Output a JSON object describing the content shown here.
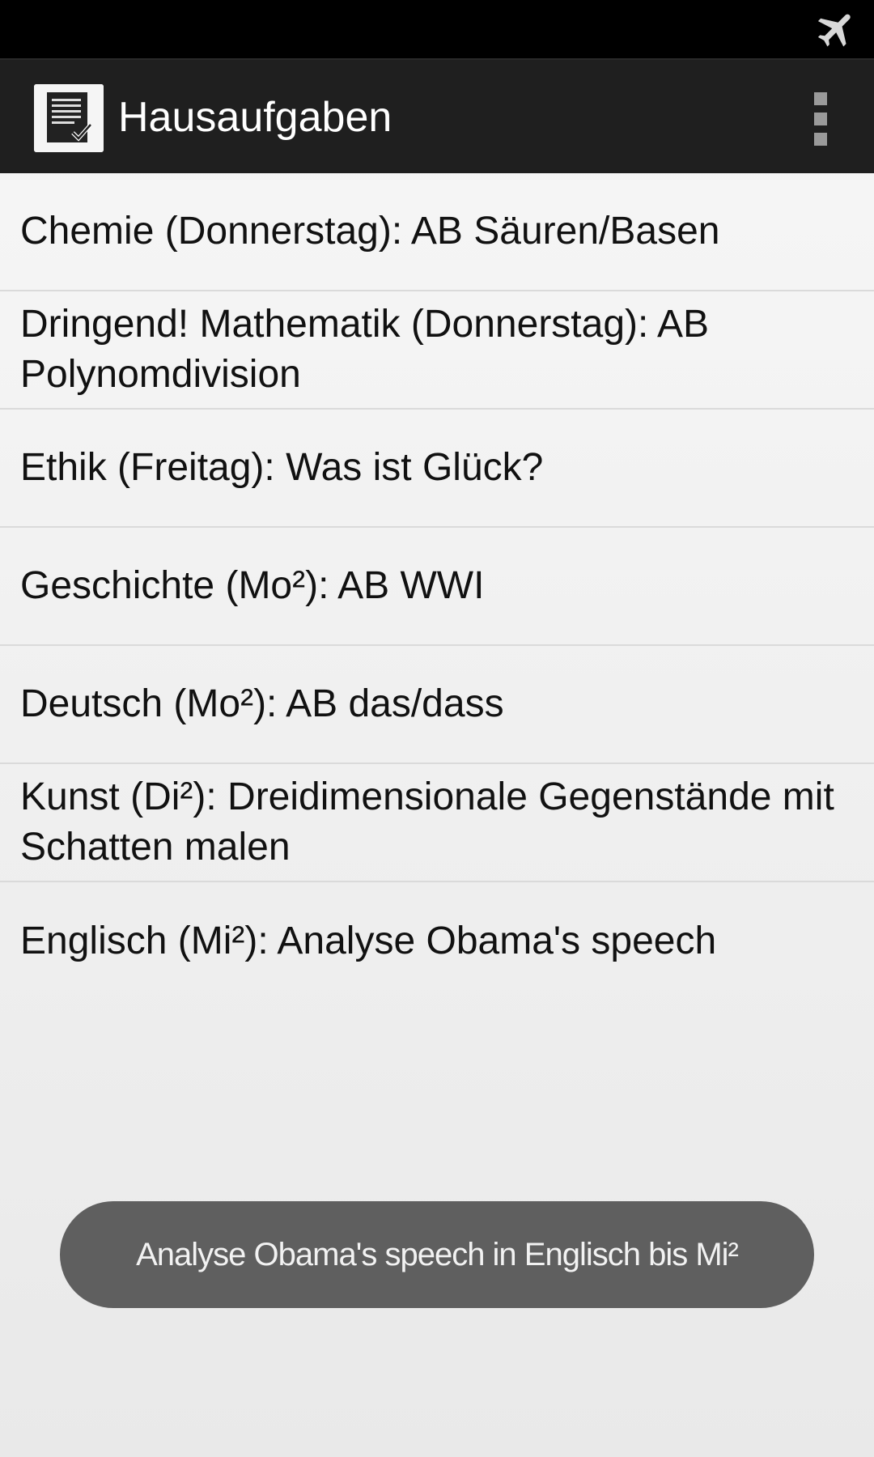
{
  "status_bar": {
    "icons": [
      "airplane-mode-icon"
    ]
  },
  "action_bar": {
    "app_icon": "homework-document-icon",
    "title": "Hausaufgaben",
    "overflow_icon": "overflow-menu-icon"
  },
  "homework_list": [
    {
      "text": "Chemie (Donnerstag): AB Säuren/Basen"
    },
    {
      "text": "Dringend! Mathematik (Donnerstag): AB Polynomdivision"
    },
    {
      "text": "Ethik (Freitag): Was ist Glück?"
    },
    {
      "text": "Geschichte (Mo²): AB WWI"
    },
    {
      "text": "Deutsch (Mo²): AB das/dass"
    },
    {
      "text": "Kunst (Di²): Dreidimensionale Gegenstände mit Schatten malen"
    },
    {
      "text": "Englisch (Mi²): Analyse Obama's speech"
    }
  ],
  "toast": {
    "message": "Analyse Obama's speech in Englisch bis Mi²"
  },
  "colors": {
    "status_bar": "#000000",
    "action_bar": "#1f1f1f",
    "list_background": "#f2f2f2",
    "divider": "#dadada",
    "toast_background": "#5f5f5f"
  }
}
